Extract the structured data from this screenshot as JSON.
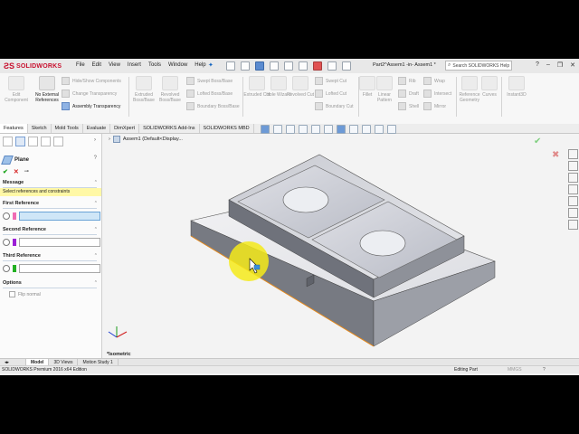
{
  "app": {
    "brand": "SOLIDWORKS",
    "document_title": "Part2^Assem1 -in- Assem1 *"
  },
  "menu": [
    "File",
    "Edit",
    "View",
    "Insert",
    "Tools",
    "Window",
    "Help"
  ],
  "search": {
    "placeholder": "Search SOLIDWORKS Help"
  },
  "ribbon": {
    "edit_component": "Edit Component",
    "no_external_references": "No External References",
    "hide_show_components": "Hide/Show Components",
    "change_transparency": "Change Transparency",
    "assembly_transparency": "Assembly Transparency",
    "extruded_boss": "Extruded Boss/Base",
    "revolved_boss": "Revolved Boss/Base",
    "swept_boss": "Swept Boss/Base",
    "lofted_boss": "Lofted Boss/Base",
    "boundary_boss": "Boundary Boss/Base",
    "extruded_cut": "Extruded Cut",
    "hole_wizard": "Hole Wizard",
    "revolved_cut": "Revolved Cut",
    "swept_cut": "Swept Cut",
    "lofted_cut": "Lofted Cut",
    "boundary_cut": "Boundary Cut",
    "fillet": "Fillet",
    "linear_pattern": "Linear Pattern",
    "rib": "Rib",
    "draft": "Draft",
    "shell": "Shell",
    "wrap": "Wrap",
    "intersect": "Intersect",
    "mirror": "Mirror",
    "reference_geometry": "Reference Geometry",
    "curves": "Curves",
    "instant3d": "Instant3D"
  },
  "tabs": [
    "Features",
    "Sketch",
    "Mold Tools",
    "Evaluate",
    "DimXpert",
    "SOLIDWORKS Add-Ins",
    "SOLIDWORKS MBD"
  ],
  "property_manager": {
    "title": "Plane",
    "message_header": "Message",
    "message": "Select references and constraints",
    "first_reference": "First Reference",
    "second_reference": "Second Reference",
    "third_reference": "Third Reference",
    "options": "Options",
    "flip_normal": "Flip normal"
  },
  "colors": {
    "first_ref": "#f06cb4",
    "second_ref": "#9b1fd6",
    "third_ref": "#22b022",
    "solidworks_red": "#c8102e"
  },
  "feature_tree": {
    "root_label": "Assem1 (Default<Display..."
  },
  "view": {
    "orientation_label": "*Isometric"
  },
  "bottom_tabs": [
    "Model",
    "3D Views",
    "Motion Study 1"
  ],
  "status": {
    "left": "SOLIDWORKS Premium 2016 x64 Edition",
    "editing": "Editing Part",
    "units": "MMGS"
  }
}
